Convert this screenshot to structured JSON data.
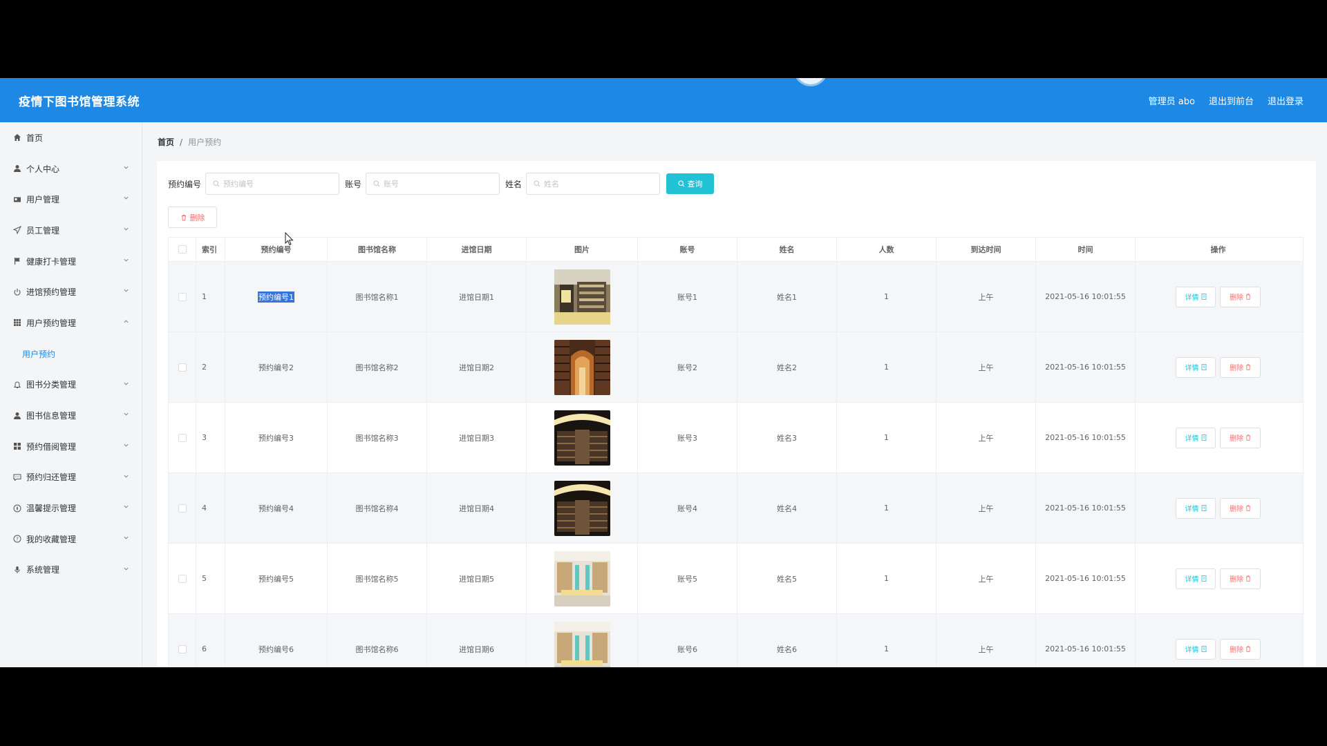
{
  "header": {
    "title": "疫情下图书馆管理系统",
    "admin": "管理员 abo",
    "to_front": "退出到前台",
    "logout": "退出登录"
  },
  "sidebar": {
    "items": [
      {
        "label": "首页",
        "icon": "home-icon",
        "has_chevron": false
      },
      {
        "label": "个人中心",
        "icon": "user-icon",
        "has_chevron": true
      },
      {
        "label": "用户管理",
        "icon": "id-card-icon",
        "has_chevron": true
      },
      {
        "label": "员工管理",
        "icon": "send-icon",
        "has_chevron": true
      },
      {
        "label": "健康打卡管理",
        "icon": "flag-icon",
        "has_chevron": true
      },
      {
        "label": "进馆预约管理",
        "icon": "power-icon",
        "has_chevron": true
      },
      {
        "label": "用户预约管理",
        "icon": "grid-icon",
        "has_chevron": true,
        "expanded": true
      },
      {
        "label": "用户预约",
        "sub": true
      },
      {
        "label": "图书分类管理",
        "icon": "bell-icon",
        "has_chevron": true
      },
      {
        "label": "图书信息管理",
        "icon": "user-icon",
        "has_chevron": true
      },
      {
        "label": "预约借阅管理",
        "icon": "apps-icon",
        "has_chevron": true
      },
      {
        "label": "预约归还管理",
        "icon": "message-icon",
        "has_chevron": true
      },
      {
        "label": "温馨提示管理",
        "icon": "compass-icon",
        "has_chevron": true
      },
      {
        "label": "我的收藏管理",
        "icon": "help-icon",
        "has_chevron": true
      },
      {
        "label": "系统管理",
        "icon": "mic-icon",
        "has_chevron": true
      }
    ]
  },
  "breadcrumb": {
    "home": "首页",
    "sep": "/",
    "current": "用户预约"
  },
  "search": {
    "no_label": "预约编号",
    "no_placeholder": "预约编号",
    "acc_label": "账号",
    "acc_placeholder": "账号",
    "name_label": "姓名",
    "name_placeholder": "姓名",
    "query": "查询"
  },
  "delete_button": "删除",
  "table": {
    "headers": [
      "索引",
      "预约编号",
      "图书馆名称",
      "进馆日期",
      "图片",
      "账号",
      "姓名",
      "人数",
      "到达时间",
      "时间",
      "操作"
    ],
    "rows": [
      {
        "idx": "1",
        "no": "预约编号1",
        "lib": "图书馆名称1",
        "date": "进馆日期1",
        "acc": "账号1",
        "name": "姓名1",
        "count": "1",
        "arrive": "上午",
        "time": "2021-05-16 10:01:55"
      },
      {
        "idx": "2",
        "no": "预约编号2",
        "lib": "图书馆名称2",
        "date": "进馆日期2",
        "acc": "账号2",
        "name": "姓名2",
        "count": "1",
        "arrive": "上午",
        "time": "2021-05-16 10:01:55"
      },
      {
        "idx": "3",
        "no": "预约编号3",
        "lib": "图书馆名称3",
        "date": "进馆日期3",
        "acc": "账号3",
        "name": "姓名3",
        "count": "1",
        "arrive": "上午",
        "time": "2021-05-16 10:01:55"
      },
      {
        "idx": "4",
        "no": "预约编号4",
        "lib": "图书馆名称4",
        "date": "进馆日期4",
        "acc": "账号4",
        "name": "姓名4",
        "count": "1",
        "arrive": "上午",
        "time": "2021-05-16 10:01:55"
      },
      {
        "idx": "5",
        "no": "预约编号5",
        "lib": "图书馆名称5",
        "date": "进馆日期5",
        "acc": "账号5",
        "name": "姓名5",
        "count": "1",
        "arrive": "上午",
        "time": "2021-05-16 10:01:55"
      },
      {
        "idx": "6",
        "no": "预约编号6",
        "lib": "图书馆名称6",
        "date": "进馆日期6",
        "acc": "账号6",
        "name": "姓名6",
        "count": "1",
        "arrive": "上午",
        "time": "2021-05-16 10:01:55"
      }
    ],
    "detail_label": "详情",
    "delete_label": "删除"
  },
  "colors": {
    "header_bg": "#1e88e5",
    "query_bg": "#21c1d6",
    "danger": "#f56c6c",
    "selection": "#3874d8"
  }
}
